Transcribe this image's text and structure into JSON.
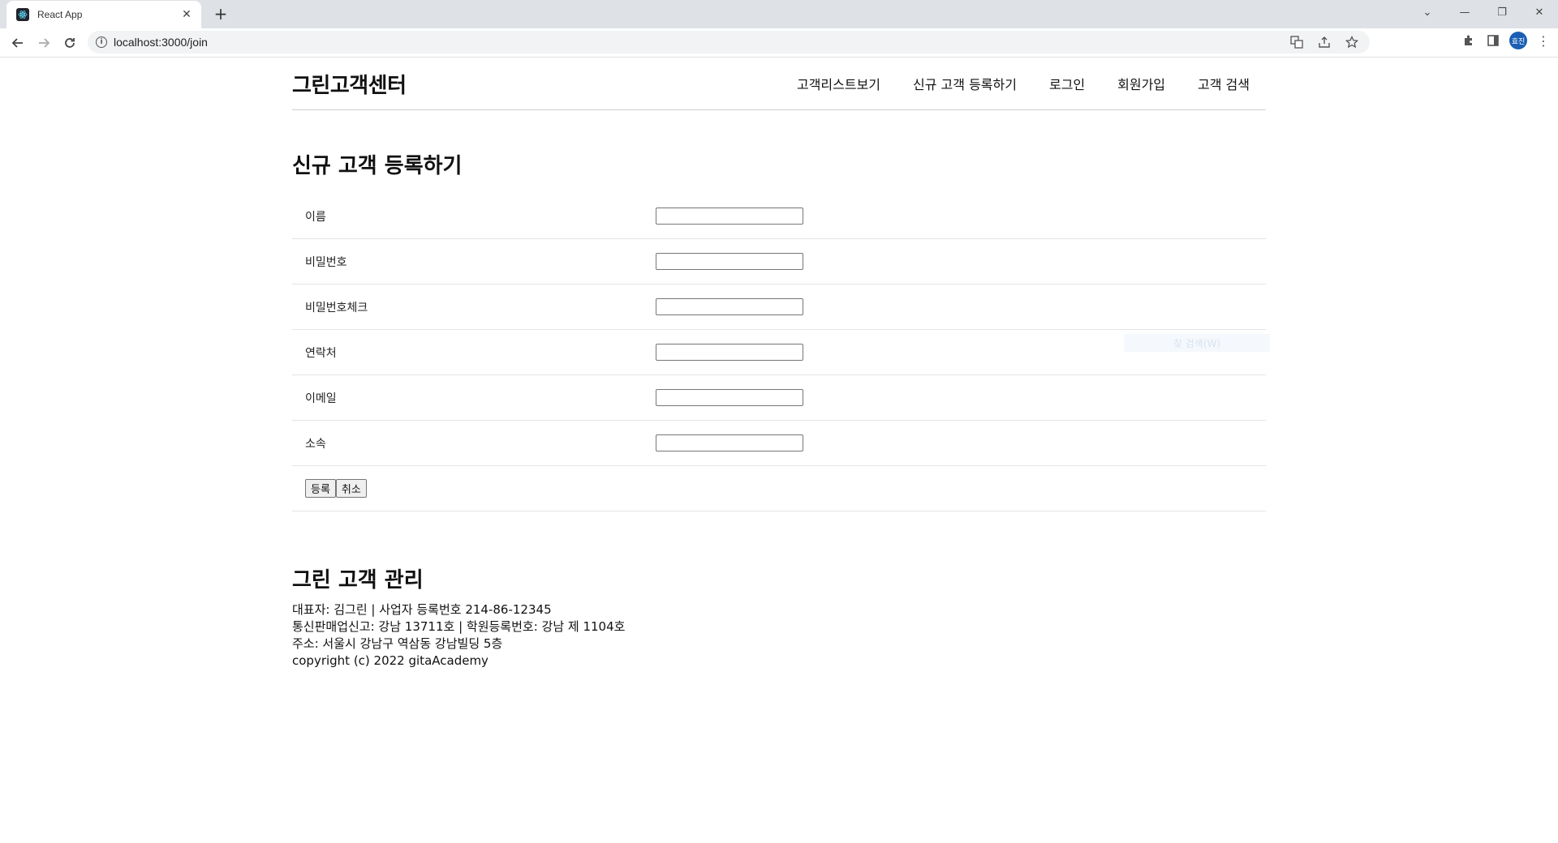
{
  "browser": {
    "tab_title": "React App",
    "url": "localhost:3000/join",
    "profile_initials": "효진"
  },
  "site": {
    "logo": "그린고객센터",
    "menu": [
      {
        "label": "고객리스트보기"
      },
      {
        "label": "신규 고객 등록하기"
      },
      {
        "label": "로그인"
      },
      {
        "label": "회원가입"
      },
      {
        "label": "고객 검색"
      }
    ]
  },
  "form": {
    "title": "신규 고객 등록하기",
    "fields": [
      {
        "label": "이름",
        "value": ""
      },
      {
        "label": "비밀번호",
        "value": ""
      },
      {
        "label": "비밀번호체크",
        "value": ""
      },
      {
        "label": "연락처",
        "value": ""
      },
      {
        "label": "이메일",
        "value": ""
      },
      {
        "label": "소속",
        "value": ""
      }
    ],
    "submit_label": "등록",
    "cancel_label": "취소"
  },
  "find_overlay": "찾 검색(W)",
  "footer": {
    "title": "그린 고객 관리",
    "lines": [
      "대표자: 김그린 | 사업자 등록번호 214-86-12345",
      "통신판매업신고: 강남 13711호 | 학원등록번호: 강남 제 1104호",
      "주소: 서울시 강남구 역삼동 강남빌딩 5층",
      "copyright (c) 2022 gitaAcademy"
    ]
  },
  "colors": {
    "tabstrip": "#dee1e6",
    "omnibox": "#f1f3f4",
    "avatar": "#1a5fb4"
  }
}
